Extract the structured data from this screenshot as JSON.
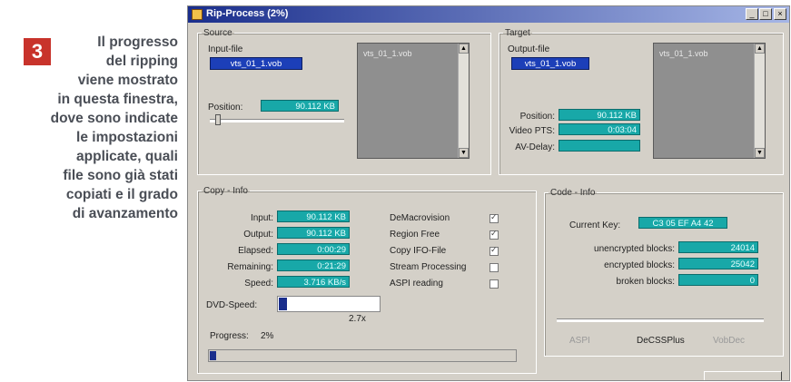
{
  "caption": {
    "number": "3",
    "lines": [
      "Il progresso",
      "del ripping",
      "viene mostrato",
      "in questa finestra,",
      "dove sono indicate",
      "le impostazioni",
      "applicate, quali",
      "file sono già stati",
      "copiati e il grado",
      "di avanzamento"
    ]
  },
  "window": {
    "title": "Rip-Process (2%)",
    "controls": [
      "_",
      "□",
      "×"
    ],
    "icon": "app-icon"
  },
  "source": {
    "legend": "Source",
    "input_label": "Input-file",
    "input_value": "vts_01_1.vob",
    "list_item": "vts_01_1.vob",
    "position_label": "Position:",
    "position_value": "90.112 KB"
  },
  "target": {
    "legend": "Target",
    "output_label": "Output-file",
    "output_value": "vts_01_1.vob",
    "list_item": "vts_01_1.vob",
    "position_label": "Position:",
    "position_value": "90.112 KB",
    "video_pts_label": "Video PTS:",
    "video_pts_value": "0:03:04",
    "av_delay_label": "AV-Delay:",
    "av_delay_value": ""
  },
  "copy_info": {
    "legend": "Copy - Info",
    "rows": [
      {
        "label": "Input:",
        "value": "90.112 KB"
      },
      {
        "label": "Output:",
        "value": "90.112 KB"
      },
      {
        "label": "Elapsed:",
        "value": "0:00:29"
      },
      {
        "label": "Remaining:",
        "value": "0:21:29"
      },
      {
        "label": "Speed:",
        "value": "3.716 KB/s"
      }
    ],
    "options": [
      {
        "label": "DeMacrovision",
        "checked": true
      },
      {
        "label": "Region Free",
        "checked": true
      },
      {
        "label": "Copy IFO-File",
        "checked": true
      },
      {
        "label": "Stream Processing",
        "checked": false
      },
      {
        "label": "ASPI reading",
        "checked": false
      }
    ],
    "dvd_speed_label": "DVD-Speed:",
    "dvd_speed_value": "2.7x",
    "dvd_speed_fraction": 0.08,
    "progress_label": "Progress:",
    "progress_value": "2%",
    "progress_fraction": 0.02
  },
  "code_info": {
    "legend": "Code - Info",
    "current_key_label": "Current Key:",
    "current_key_value": "C3 05 EF A4 42",
    "rows": [
      {
        "label": "unencrypted blocks:",
        "value": "24014"
      },
      {
        "label": "encrypted blocks:",
        "value": "25042"
      },
      {
        "label": "broken blocks:",
        "value": "0"
      }
    ],
    "methods": [
      "ASPI",
      "DeCSSPlus",
      "VobDec"
    ]
  }
}
